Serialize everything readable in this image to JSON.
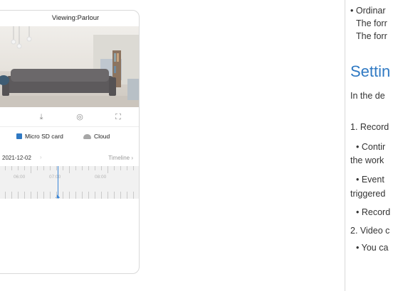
{
  "phone": {
    "header_title": "Viewing:Parlour",
    "controls": [
      "download-icon",
      "camera-icon",
      "fullscreen-icon"
    ],
    "storage": {
      "micro_sd_label": "Micro SD card",
      "cloud_label": "Cloud"
    },
    "date": "2021-12-02",
    "timeline_link": "Timeline",
    "timeline_labels": [
      "06:00",
      "07:00",
      "08:00"
    ]
  },
  "doc": {
    "lines": [
      "• Ordinar",
      "The forr",
      "The forr",
      "Settin",
      "In the de",
      "1. Record",
      "• Contir",
      "the work",
      "• Event",
      "triggered",
      "• Record",
      "2. Video c",
      "• You ca"
    ]
  }
}
